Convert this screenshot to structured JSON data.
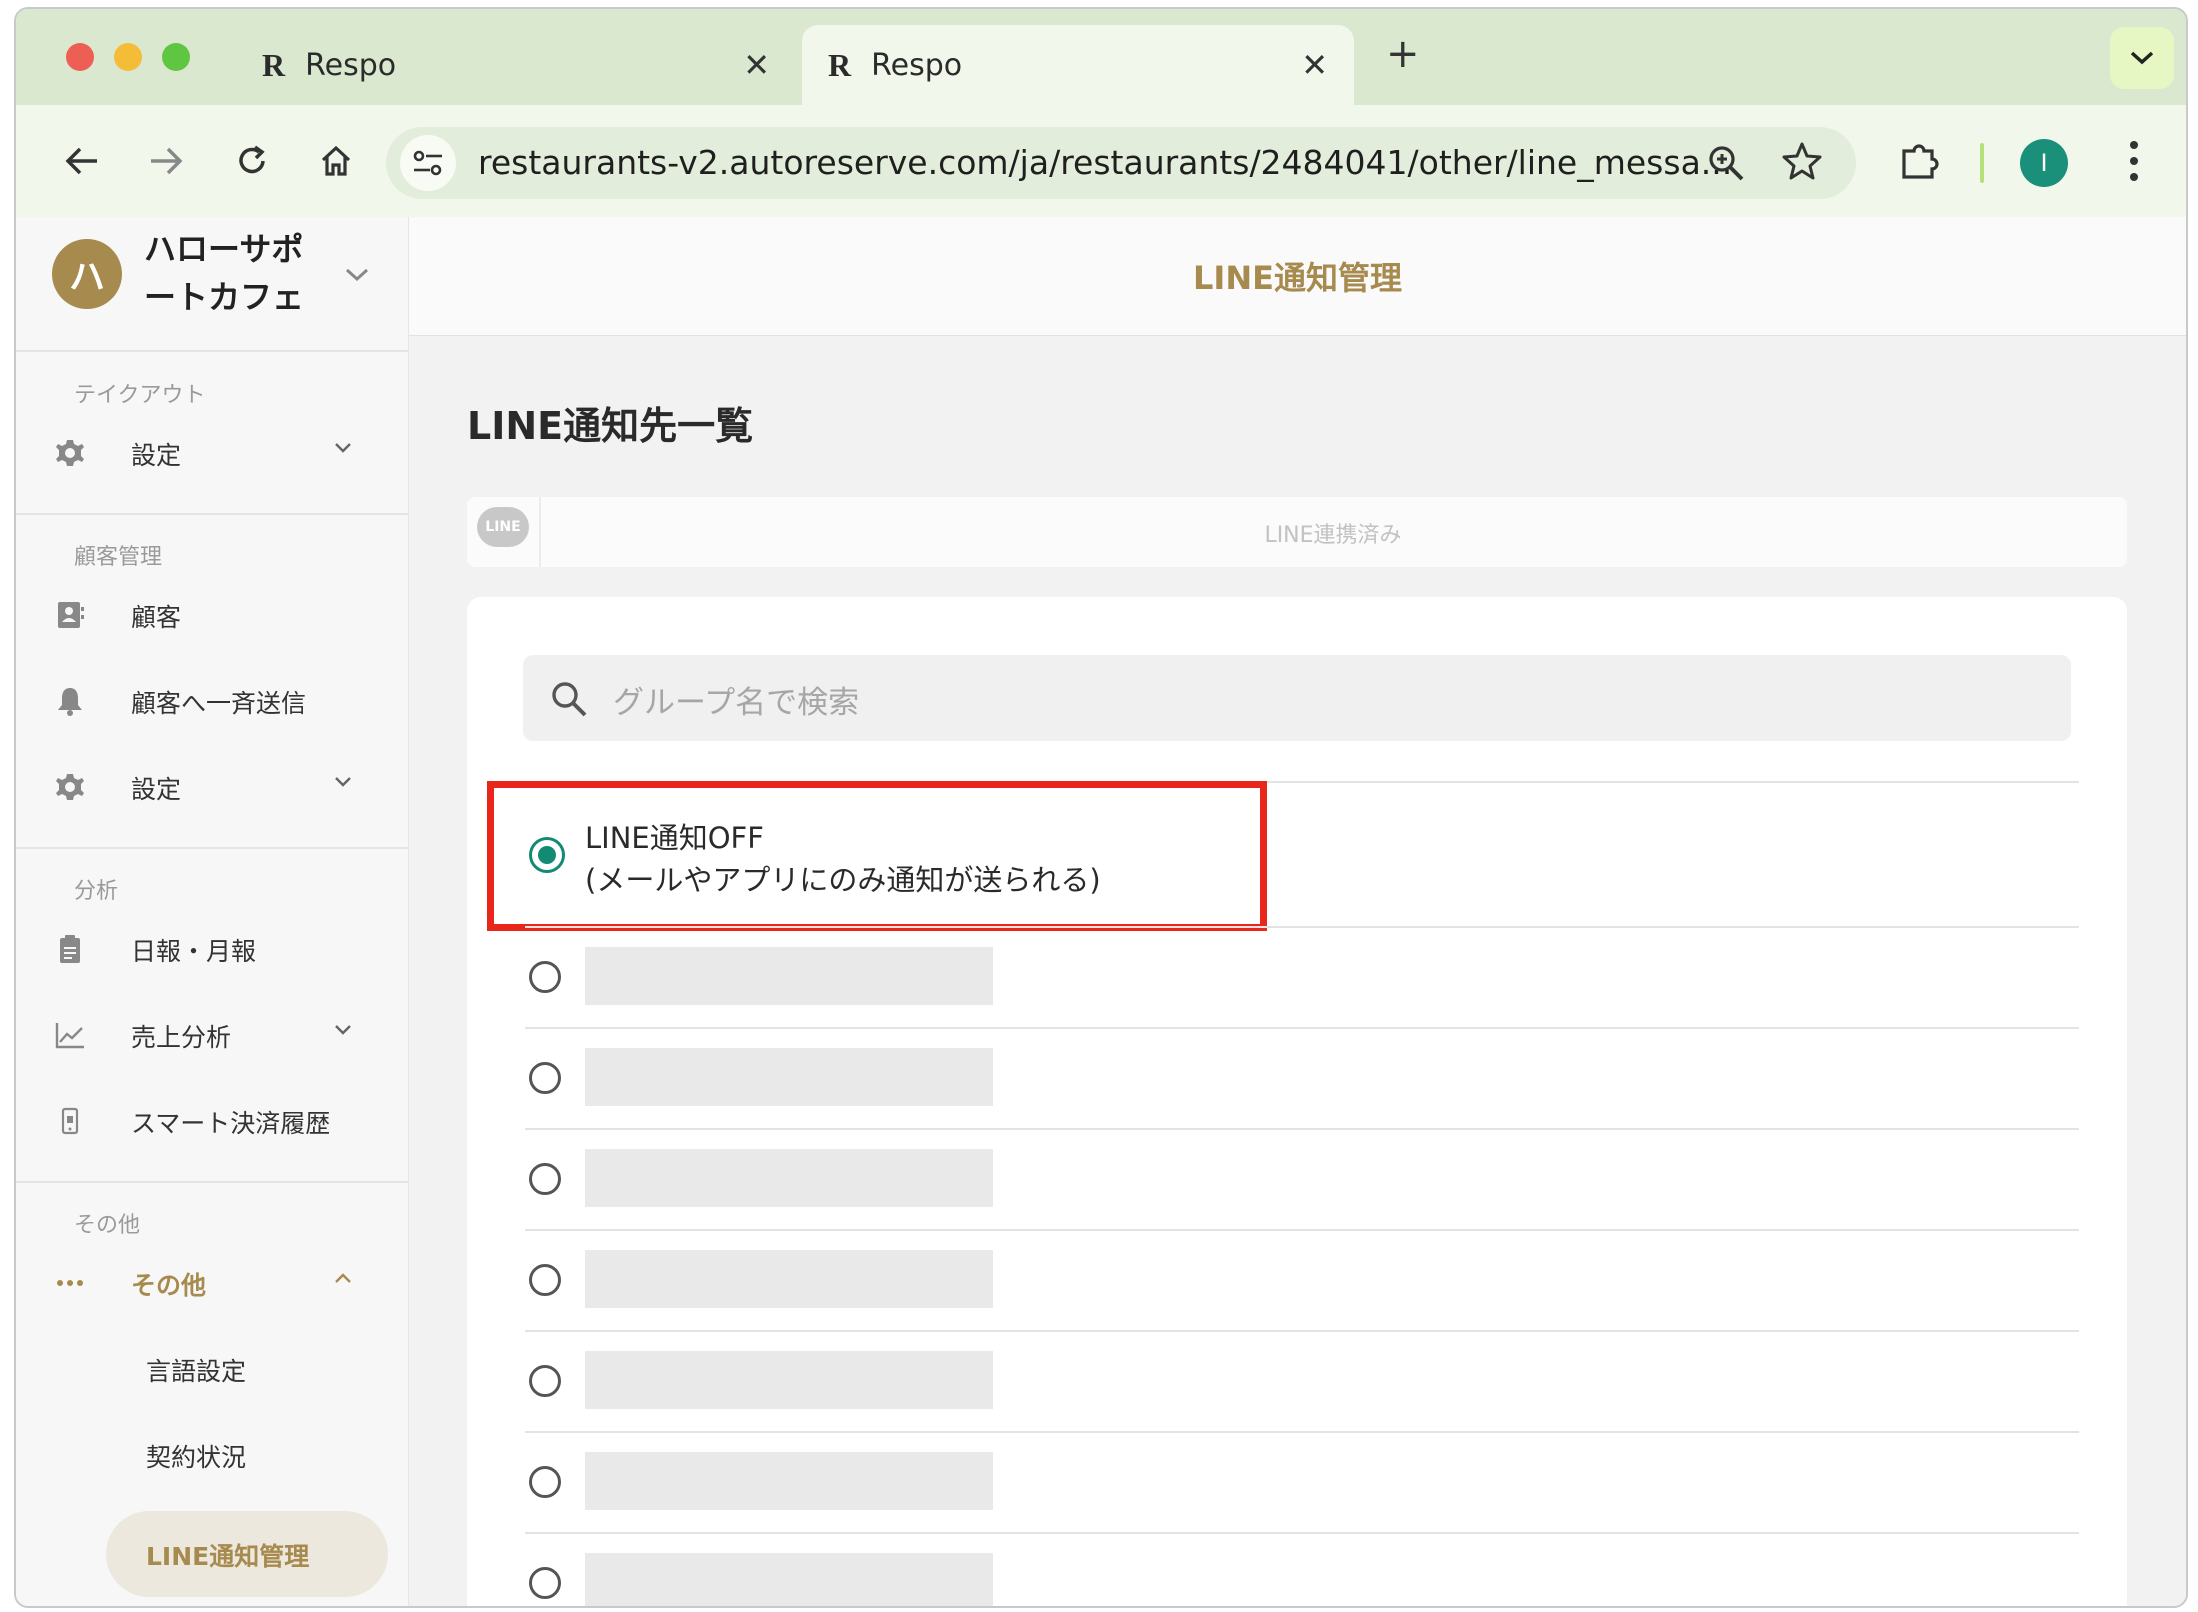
{
  "browser": {
    "tabs": [
      {
        "title": "Respo",
        "logo": "R"
      },
      {
        "title": "Respo",
        "logo": "R"
      }
    ],
    "new_tab": "+",
    "url": "restaurants-v2.autoreserve.com/ja/restaurants/2484041/other/line_messa...",
    "profile_initial": "I",
    "colors": {
      "tabbar": "#d9e8cf",
      "profile": "#1a8f7a"
    }
  },
  "sidebar": {
    "account": {
      "avatar_initial": "ハ",
      "name": "ハローサポートカフェ"
    },
    "sections": [
      {
        "title": "テイクアウト",
        "items": [
          {
            "label": "設定",
            "icon": "gear-icon",
            "has_chevron": true
          }
        ]
      },
      {
        "title": "顧客管理",
        "items": [
          {
            "label": "顧客",
            "icon": "contact-card-icon"
          },
          {
            "label": "顧客へ一斉送信",
            "icon": "bell-icon"
          },
          {
            "label": "設定",
            "icon": "gear-icon",
            "has_chevron": true
          }
        ]
      },
      {
        "title": "分析",
        "items": [
          {
            "label": "日報・月報",
            "icon": "clipboard-icon"
          },
          {
            "label": "売上分析",
            "icon": "chart-line-icon",
            "has_chevron": true
          },
          {
            "label": "スマート決済履歴",
            "icon": "phone-payment-icon"
          }
        ]
      },
      {
        "title": "その他",
        "items": [
          {
            "label": "その他",
            "icon": "more-dots-icon",
            "expanded": true
          },
          {
            "label": "言語設定"
          },
          {
            "label": "契約状況"
          },
          {
            "label": "LINE通知管理",
            "active": true
          }
        ]
      }
    ],
    "colors": {
      "accent": "#a78a4e",
      "active_bg": "#ece8de"
    }
  },
  "header": {
    "title": "LINE通知管理"
  },
  "main": {
    "heading": "LINE通知先一覧",
    "line_badge": {
      "icon_text": "LINE",
      "status": "LINE連携済み"
    },
    "search": {
      "placeholder": "グループ名で検索"
    },
    "options": [
      {
        "line1": "LINE通知OFF",
        "line2": "(メールやアプリにのみ通知が送られる)",
        "selected": true
      }
    ],
    "placeholder_rows": 7,
    "colors": {
      "radio_selected": "#138a73",
      "highlight_border": "#e8271a"
    }
  }
}
